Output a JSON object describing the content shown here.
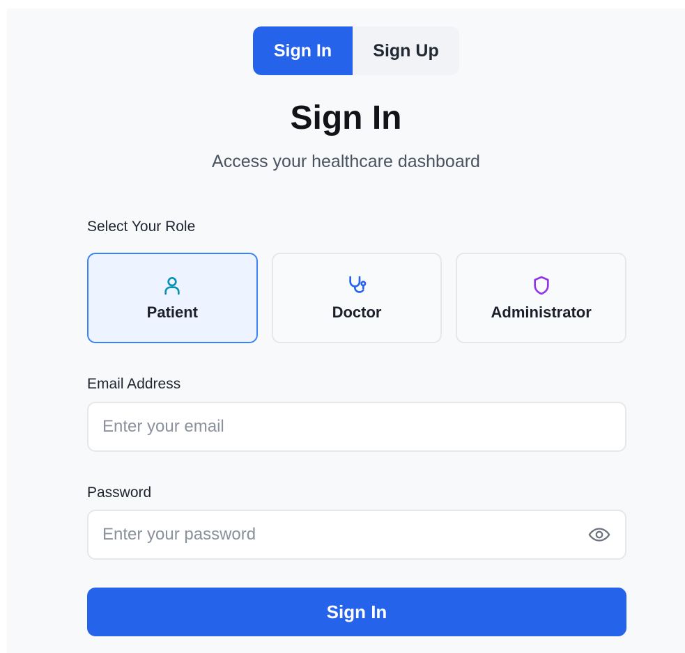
{
  "tabs": {
    "sign_in": "Sign In",
    "sign_up": "Sign Up",
    "active": "sign_in"
  },
  "heading": "Sign In",
  "subheading": "Access your healthcare dashboard",
  "role_section": {
    "label": "Select Your Role",
    "selected": "patient",
    "roles": [
      {
        "id": "patient",
        "label": "Patient",
        "icon": "user-icon",
        "icon_color": "#0891b2"
      },
      {
        "id": "doctor",
        "label": "Doctor",
        "icon": "stethoscope-icon",
        "icon_color": "#2563eb"
      },
      {
        "id": "administrator",
        "label": "Administrator",
        "icon": "shield-icon",
        "icon_color": "#9333ea"
      }
    ]
  },
  "email": {
    "label": "Email Address",
    "placeholder": "Enter your email",
    "value": ""
  },
  "password": {
    "label": "Password",
    "placeholder": "Enter your password",
    "value": "",
    "toggle_icon": "eye-icon"
  },
  "submit_label": "Sign In",
  "colors": {
    "primary": "#2563eb",
    "selected_role_bg": "#edf4ff",
    "selected_role_border": "#3b82f6",
    "page_bg": "#f8f9fb"
  }
}
